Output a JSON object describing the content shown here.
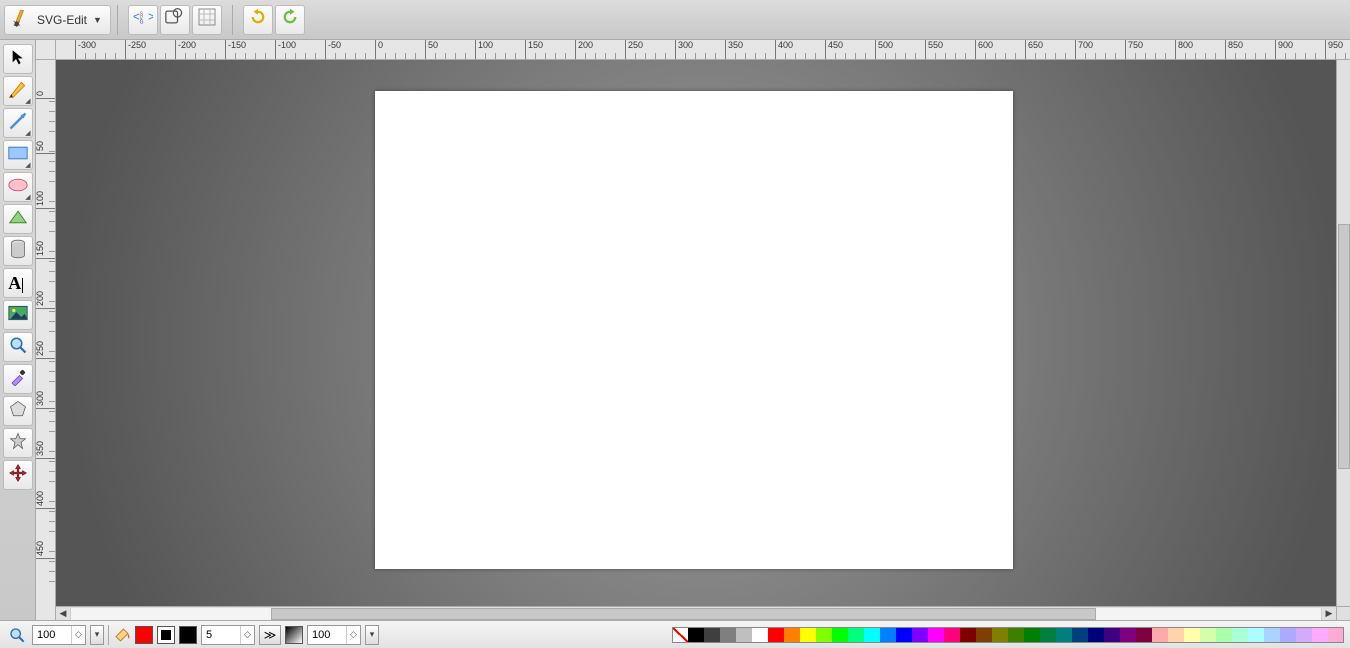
{
  "app": {
    "title": "SVG-Edit"
  },
  "topbar": {
    "buttons": {
      "svg_source": "svg-source",
      "doc_props": "document-properties",
      "wireframe": "wireframe-mode",
      "undo": "undo",
      "redo": "redo"
    }
  },
  "tools": [
    "select",
    "pencil",
    "line",
    "rect",
    "ellipse",
    "path",
    "cylinder",
    "text",
    "image",
    "zoom",
    "eyedropper",
    "polygon",
    "star",
    "move"
  ],
  "ruler": {
    "h_labels": [
      "-300",
      "-250",
      "-200",
      "-150",
      "-100",
      "-50",
      "0",
      "50",
      "100",
      "150",
      "200",
      "250",
      "300",
      "350",
      "400",
      "450",
      "500",
      "550",
      "600",
      "650",
      "700",
      "750",
      "800",
      "850",
      "900",
      "950"
    ],
    "v_labels": [
      "0",
      "50",
      "100",
      "150",
      "200",
      "250",
      "300",
      "350",
      "400",
      "450"
    ]
  },
  "bottom": {
    "zoom_value": "100",
    "fill_color": "#ff0000",
    "stroke_color": "#000000",
    "stroke_width": "5",
    "opacity_value": "100"
  },
  "palette": [
    "none",
    "#000000",
    "#3f3f3f",
    "#7f7f7f",
    "#bfbfbf",
    "#ffffff",
    "#ff0000",
    "#ff7f00",
    "#ffff00",
    "#7fff00",
    "#00ff00",
    "#00ff7f",
    "#00ffff",
    "#007fff",
    "#0000ff",
    "#7f00ff",
    "#ff00ff",
    "#ff007f",
    "#7f0000",
    "#7f3f00",
    "#7f7f00",
    "#3f7f00",
    "#007f00",
    "#007f3f",
    "#007f7f",
    "#003f7f",
    "#00007f",
    "#3f007f",
    "#7f007f",
    "#7f003f",
    "#ffaaaa",
    "#ffd4aa",
    "#ffffaa",
    "#d4ffaa",
    "#aaffaa",
    "#aaffd4",
    "#aaffff",
    "#aad4ff",
    "#aaaaff",
    "#d4aaff",
    "#ffaaff",
    "#ffaad4"
  ]
}
